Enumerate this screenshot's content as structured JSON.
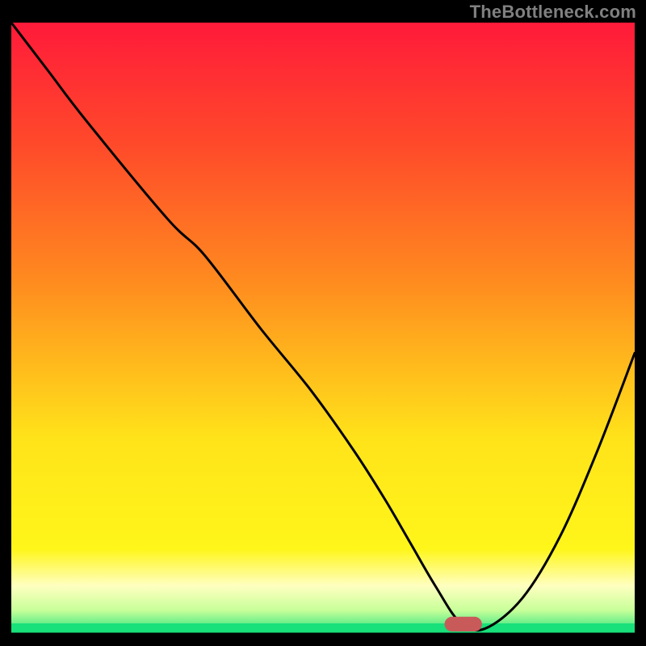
{
  "watermark": "TheBottleneck.com",
  "colors": {
    "red": "#ff1a3a",
    "orange": "#ff8a1f",
    "yellow": "#fff61a",
    "pale_yellow": "#ffffc0",
    "green": "#18e07a",
    "marker": "#c95a5a",
    "curve": "#000000",
    "axis": "#000000",
    "frame": "#000000"
  },
  "chart_data": {
    "type": "line",
    "title": "",
    "xlabel": "",
    "ylabel": "",
    "xlim": [
      0,
      100
    ],
    "ylim": [
      0,
      100
    ],
    "x": [
      0,
      6,
      12,
      25,
      31,
      40,
      48,
      55,
      60,
      64,
      68,
      72,
      76,
      82,
      88,
      94,
      100
    ],
    "values": [
      100,
      92,
      84,
      68,
      62,
      50,
      40,
      30,
      22,
      15,
      8,
      2,
      1,
      6,
      16,
      30,
      46
    ],
    "optimum_marker": {
      "x": 72.5,
      "width": 6,
      "height": 2.4
    }
  }
}
